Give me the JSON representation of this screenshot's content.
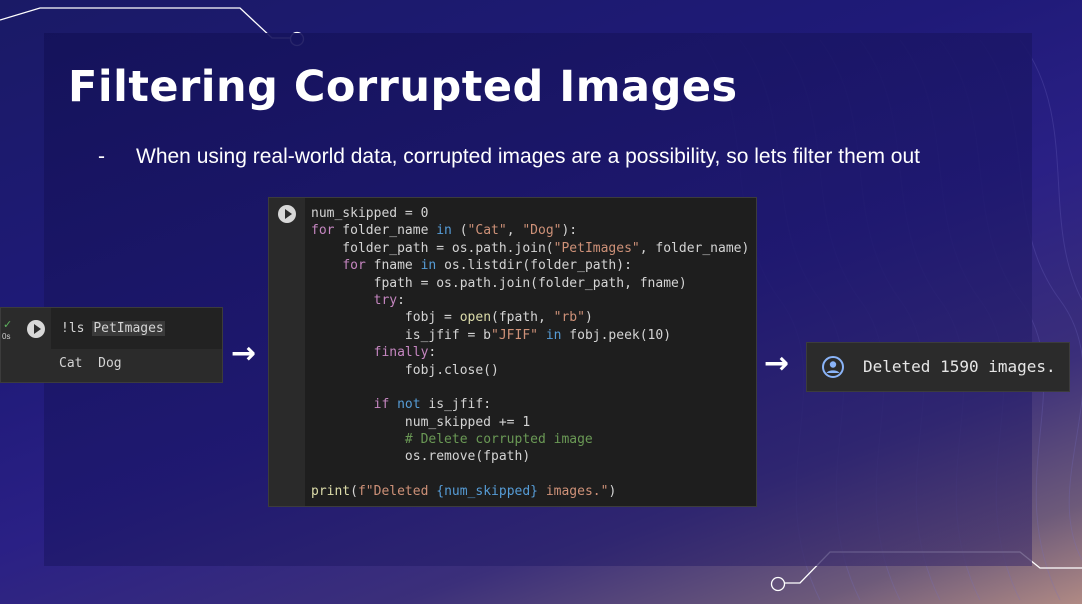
{
  "slide": {
    "title": "Filtering Corrupted Images",
    "bullet_marker": "-",
    "bullet": "When using real-world data, corrupted images are a possibility, so lets filter them out"
  },
  "left_cell": {
    "status_check": "✓",
    "duration": "0s",
    "command": "!ls ",
    "command_arg": "PetImages",
    "output": "Cat  Dog"
  },
  "arrows": [
    "→",
    "→"
  ],
  "code_cell": {
    "lines": [
      [
        {
          "t": "num_skipped = 0",
          "c": ""
        }
      ],
      [
        {
          "t": "for",
          "c": "kc"
        },
        {
          "t": " folder_name ",
          "c": ""
        },
        {
          "t": "in",
          "c": "kw"
        },
        {
          "t": " (",
          "c": ""
        },
        {
          "t": "\"Cat\"",
          "c": "str"
        },
        {
          "t": ", ",
          "c": ""
        },
        {
          "t": "\"Dog\"",
          "c": "str"
        },
        {
          "t": "):",
          "c": ""
        }
      ],
      [
        {
          "t": "    folder_path = os.path.join(",
          "c": ""
        },
        {
          "t": "\"PetImages\"",
          "c": "str"
        },
        {
          "t": ", folder_name)",
          "c": ""
        }
      ],
      [
        {
          "t": "    ",
          "c": ""
        },
        {
          "t": "for",
          "c": "kc"
        },
        {
          "t": " fname ",
          "c": ""
        },
        {
          "t": "in",
          "c": "kw"
        },
        {
          "t": " os.listdir(folder_path):",
          "c": ""
        }
      ],
      [
        {
          "t": "        fpath = os.path.join(folder_path, fname)",
          "c": ""
        }
      ],
      [
        {
          "t": "        ",
          "c": ""
        },
        {
          "t": "try",
          "c": "kc"
        },
        {
          "t": ":",
          "c": ""
        }
      ],
      [
        {
          "t": "            fobj = ",
          "c": ""
        },
        {
          "t": "open",
          "c": "fn"
        },
        {
          "t": "(fpath, ",
          "c": ""
        },
        {
          "t": "\"rb\"",
          "c": "str"
        },
        {
          "t": ")",
          "c": ""
        }
      ],
      [
        {
          "t": "            is_jfif = b",
          "c": ""
        },
        {
          "t": "\"JFIF\"",
          "c": "str"
        },
        {
          "t": " ",
          "c": ""
        },
        {
          "t": "in",
          "c": "kw"
        },
        {
          "t": " fobj.peek(10)",
          "c": ""
        }
      ],
      [
        {
          "t": "        ",
          "c": ""
        },
        {
          "t": "finally",
          "c": "kc"
        },
        {
          "t": ":",
          "c": ""
        }
      ],
      [
        {
          "t": "            fobj.close()",
          "c": ""
        }
      ],
      [
        {
          "t": "",
          "c": ""
        }
      ],
      [
        {
          "t": "        ",
          "c": ""
        },
        {
          "t": "if",
          "c": "kc"
        },
        {
          "t": " ",
          "c": ""
        },
        {
          "t": "not",
          "c": "kw"
        },
        {
          "t": " is_jfif:",
          "c": ""
        }
      ],
      [
        {
          "t": "            num_skipped += 1",
          "c": ""
        }
      ],
      [
        {
          "t": "            ",
          "c": ""
        },
        {
          "t": "# Delete corrupted image",
          "c": "cm"
        }
      ],
      [
        {
          "t": "            os.remove(fpath)",
          "c": ""
        }
      ],
      [
        {
          "t": "",
          "c": ""
        }
      ],
      [
        {
          "t": "print",
          "c": "fn"
        },
        {
          "t": "(",
          "c": ""
        },
        {
          "t": "f\"Deleted ",
          "c": "str"
        },
        {
          "t": "{num_skipped}",
          "c": "kw"
        },
        {
          "t": " images.\"",
          "c": "str"
        },
        {
          "t": ")",
          "c": ""
        }
      ]
    ]
  },
  "output_cell": {
    "icon": "user-circle-icon",
    "text": "Deleted 1590 images."
  },
  "colors": {
    "keyword": "#569cd6",
    "control": "#c586c0",
    "string": "#ce9178",
    "comment": "#6a9955",
    "builtin": "#dcdcaa"
  }
}
